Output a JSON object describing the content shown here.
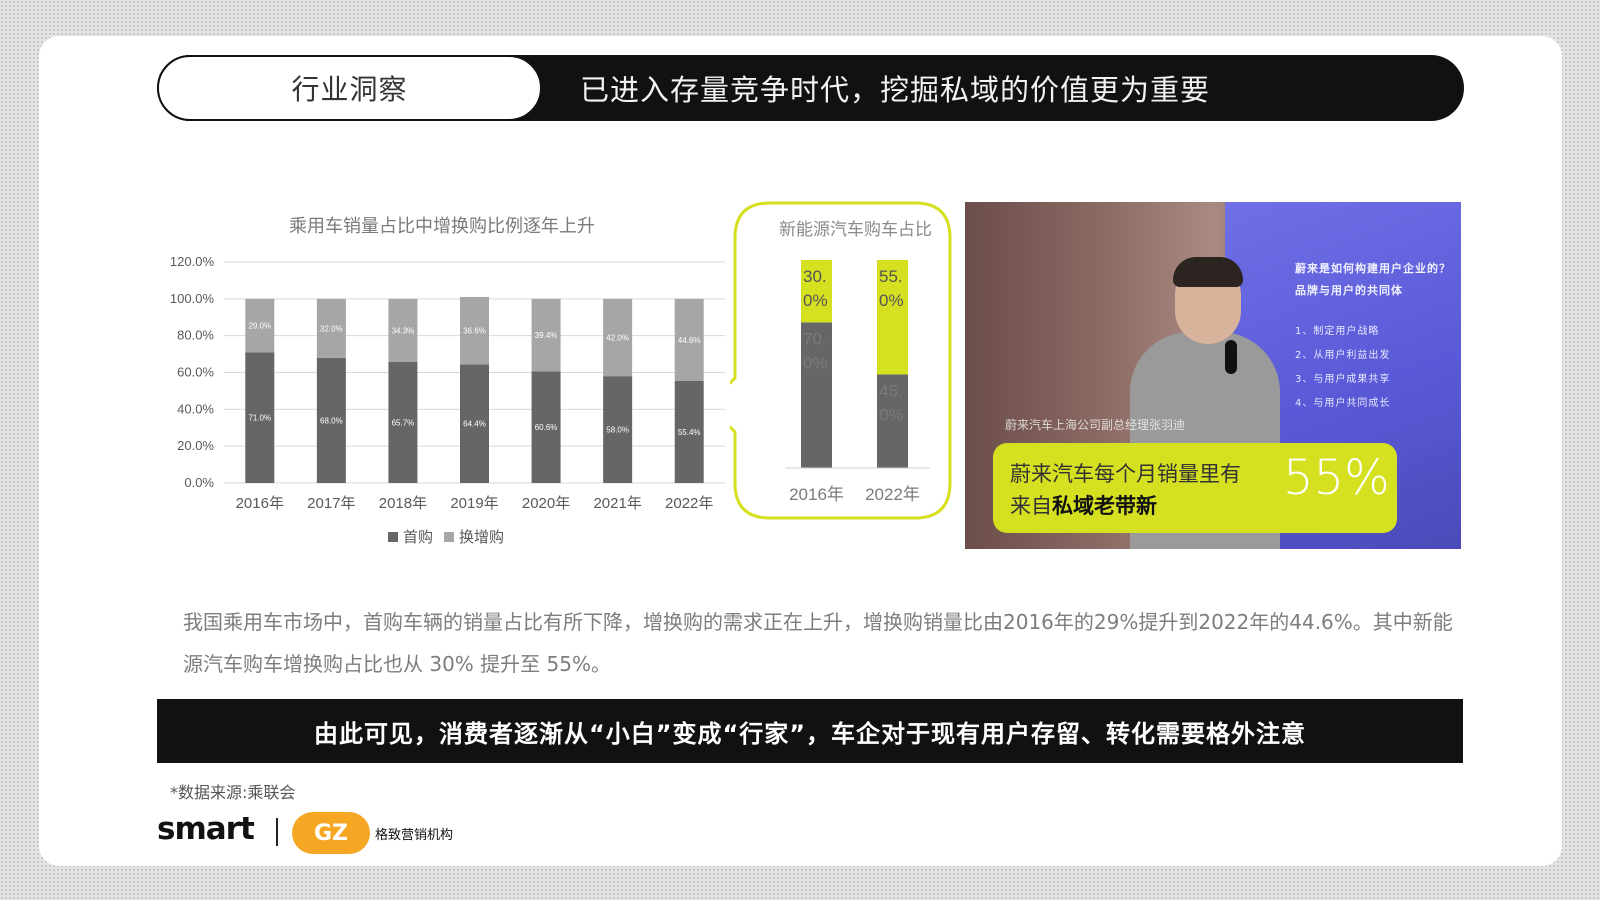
{
  "header": {
    "tag": "行业洞察",
    "headline": "已进入存量竞争时代，挖掘私域的价值更为重要"
  },
  "chart_data": [
    {
      "type": "bar",
      "stacked": true,
      "title": "乘用车销量占比中增换购比例逐年上升",
      "categories": [
        "2016年",
        "2017年",
        "2018年",
        "2019年",
        "2020年",
        "2021年",
        "2022年"
      ],
      "y_ticks": [
        "0.0%",
        "20.0%",
        "40.0%",
        "60.0%",
        "80.0%",
        "100.0%",
        "120.0%"
      ],
      "ylim": [
        0,
        120
      ],
      "grid": true,
      "legend_position": "bottom",
      "series": [
        {
          "name": "首购",
          "color": "#666666",
          "values": [
            71.0,
            68.0,
            65.7,
            64.4,
            60.6,
            58.0,
            55.4
          ],
          "labels": [
            "71.0%",
            "68.0%",
            "65.7%",
            "64.4%",
            "60.6%",
            "58.0%",
            "55.4%"
          ]
        },
        {
          "name": "换增购",
          "color": "#a6a6a6",
          "values": [
            29.0,
            32.0,
            34.3,
            36.6,
            39.4,
            42.0,
            44.6
          ],
          "labels": [
            "29.0%",
            "32.0%",
            "34.3%",
            "36.6%",
            "39.4%",
            "42.0%",
            "44.6%"
          ]
        }
      ]
    },
    {
      "type": "bar",
      "stacked": true,
      "title": "新能源汽车购车占比",
      "categories": [
        "2016年",
        "2022年"
      ],
      "ylim": [
        0,
        100
      ],
      "series": [
        {
          "color": "#666666",
          "values": [
            70,
            45
          ],
          "labels": [
            "70.\n0%",
            "45.\n0%"
          ]
        },
        {
          "color": "#d5e021",
          "values": [
            30,
            55
          ],
          "labels": [
            "30.\n0%",
            "55.\n0%"
          ]
        }
      ]
    }
  ],
  "photo": {
    "caption": "蔚来汽车上海公司副总经理张羽迪",
    "screen_line1": "蔚来是如何构建用户企业的？",
    "screen_line2": "品牌与用户的共同体",
    "screen_items": [
      "1、制定用户战略",
      "2、从用户利益出发",
      "3、与用户成果共享",
      "4、与用户共同成长"
    ]
  },
  "callout": {
    "line1": "蔚来汽车每个月销量里有",
    "line2_prefix": "来自",
    "line2_bold": "私域老带新",
    "percent": "55%"
  },
  "body": {
    "paragraph": "我国乘用车市场中，首购车辆的销量占比有所下降，增换购的需求正在上升，增换购销量比由2016年的29%提升到2022年的44.6%。其中新能源汽车购车增换购占比也从 30% 提升至 55%。"
  },
  "banner": {
    "text": "由此可见，消费者逐渐从“小白”变成“行家”，车企对于现有用户存留、转化需要格外注意"
  },
  "source": "*数据来源:乘联会",
  "footer": {
    "brand": "smart",
    "partner_mark": "GZ",
    "partner_name": "格致营销机构"
  }
}
